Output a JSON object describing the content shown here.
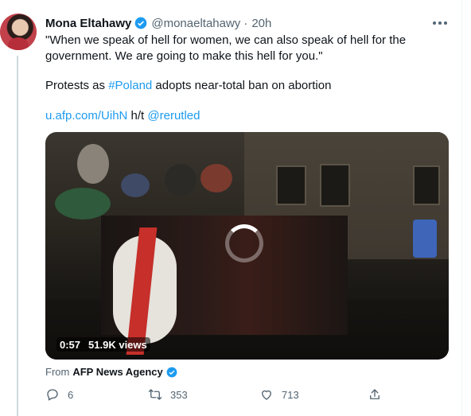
{
  "tweet": {
    "author_name": "Mona Eltahawy",
    "handle": "@monaeltahawy",
    "separator": "·",
    "time": "20h",
    "line1": "\"When we speak of hell for women, we can also speak of hell for the",
    "line2": "government. We are going to make this hell for you.\"",
    "protests_prefix": "Protests as ",
    "hashtag": "#Poland",
    "protests_suffix": " adopts near-total ban on abortion",
    "short_link": "u.afp.com/UihN",
    "ht": " h/t ",
    "mention": "@rerutled"
  },
  "media": {
    "duration": "0:57",
    "views": "51.9K views"
  },
  "source": {
    "from_label": "From",
    "org_name": "AFP News Agency"
  },
  "actions": {
    "replies": "6",
    "retweets": "353",
    "likes": "713"
  },
  "colors": {
    "accent": "#1d9bf0",
    "text": "#0f1419",
    "secondary": "#536471"
  },
  "icons": [
    "verified-badge-icon",
    "more-icon",
    "reply-icon",
    "retweet-icon",
    "like-icon",
    "share-icon"
  ]
}
